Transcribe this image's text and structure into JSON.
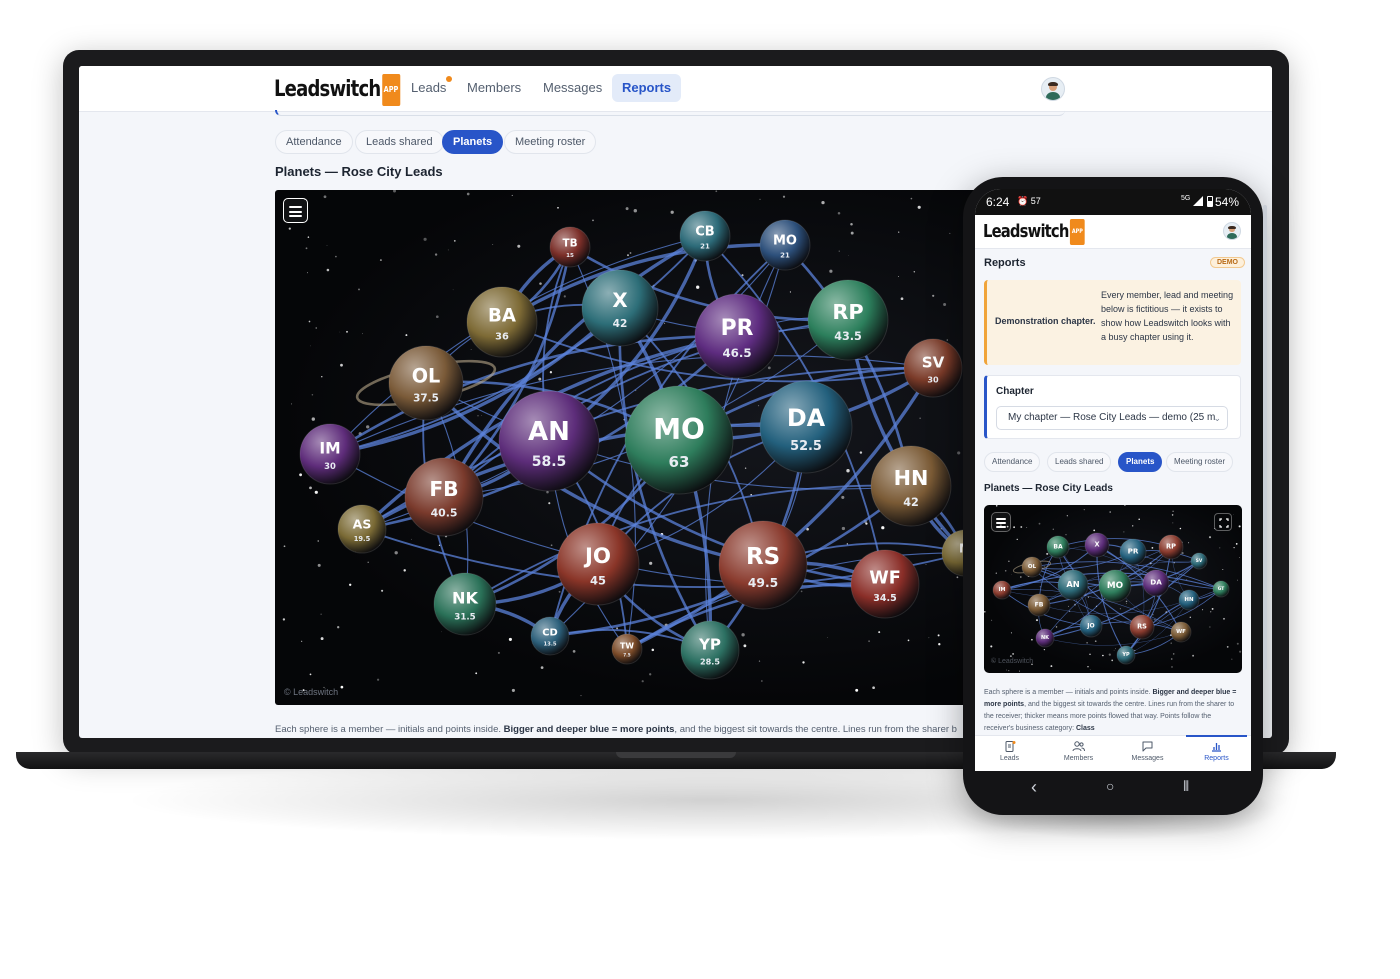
{
  "app": {
    "logo_text": "Leadswitch",
    "logo_tag": "APP"
  },
  "desktop": {
    "nav": [
      {
        "label": "Leads",
        "has_dot": true
      },
      {
        "label": "Members"
      },
      {
        "label": "Messages"
      },
      {
        "label": "Reports",
        "active": true
      }
    ],
    "tabs": [
      {
        "label": "Attendance"
      },
      {
        "label": "Leads shared"
      },
      {
        "label": "Planets",
        "active": true
      },
      {
        "label": "Meeting roster"
      }
    ],
    "title": "Planets — Rose City Leads",
    "copyright": "© Leadswitch",
    "footnote_pre": "Each sphere is a member — initials and points inside. ",
    "footnote_bold": "Bigger and deeper blue = more points",
    "footnote_post": ", and the biggest sit towards the centre. Lines run from the sharer b"
  },
  "phone": {
    "status": {
      "time": "6:24",
      "icons_left": "⏰ 57",
      "network": "5G",
      "battery": "54%"
    },
    "page_title": "Reports",
    "demo_badge": "DEMO",
    "demo_label": "Demonstration chapter.",
    "demo_text": "Every member, lead and meeting below is fictitious — it exists to show how Leadswitch looks with a busy chapter using it.",
    "chapter_label": "Chapter",
    "chapter_select": "My chapter — Rose City Leads — demo (25 m",
    "tabs": [
      {
        "label": "Attendance"
      },
      {
        "label": "Leads shared"
      },
      {
        "label": "Planets",
        "active": true
      },
      {
        "label": "Meeting roster"
      }
    ],
    "title": "Planets — Rose City Leads",
    "copyright": "© Leadswitch",
    "footnote_pre": "Each sphere is a member — initials and points inside. ",
    "footnote_bold1": "Bigger and deeper blue = more points",
    "footnote_mid": ", and the biggest sit towards the centre. Lines run from the sharer to the receiver; thicker means more points flowed that way. Points follow the receiver's business category: ",
    "footnote_bold2": "Class",
    "tabbar": [
      {
        "label": "Leads",
        "icon": "document-icon",
        "has_dot": true
      },
      {
        "label": "Members",
        "icon": "people-icon"
      },
      {
        "label": "Messages",
        "icon": "chat-icon"
      },
      {
        "label": "Reports",
        "icon": "bar-chart-icon",
        "active": true
      }
    ],
    "gestures": {
      "back": "‹",
      "home": "○",
      "recent": "⦀"
    }
  },
  "planets": [
    {
      "initials": "MO",
      "points": 63,
      "color": "#2e7d5c"
    },
    {
      "initials": "AN",
      "points": 58.5,
      "color": "#5d2d7a"
    },
    {
      "initials": "DA",
      "points": 52.5,
      "color": "#23607d"
    },
    {
      "initials": "RS",
      "points": 49.5,
      "color": "#8a3b2e"
    },
    {
      "initials": "PR",
      "points": 46.5,
      "color": "#5e2c80"
    },
    {
      "initials": "JO",
      "points": 45,
      "color": "#8a3528"
    },
    {
      "initials": "RP",
      "points": 43.5,
      "color": "#2c7f5c"
    },
    {
      "initials": "X",
      "points": 42,
      "color": "#2d6e78"
    },
    {
      "initials": "HN",
      "points": 42,
      "color": "#7a5a35"
    },
    {
      "initials": "FB",
      "points": 40.5,
      "color": "#7a3a2c"
    },
    {
      "initials": "OL",
      "points": 37.5,
      "color": "#7a5a38"
    },
    {
      "initials": "BA",
      "points": 36,
      "color": "#7d6a35"
    },
    {
      "initials": "WF",
      "points": 34.5,
      "color": "#8a2e28"
    },
    {
      "initials": "NK",
      "points": 31.5,
      "color": "#2a7158"
    },
    {
      "initials": "IM",
      "points": 30,
      "color": "#5e2c7a"
    },
    {
      "initials": "SV",
      "points": 30,
      "color": "#7a3a28"
    },
    {
      "initials": "YP",
      "points": 28.5,
      "color": "#2c7062"
    },
    {
      "initials": "CB",
      "points": 21,
      "color": "#2c6a78"
    },
    {
      "initials": "MO",
      "points": 21,
      "color": "#2c4f7a"
    },
    {
      "initials": "AS",
      "points": 19.5,
      "color": "#7a6a35"
    },
    {
      "initials": "TB",
      "points": 15,
      "color": "#7a2e28"
    },
    {
      "initials": "CD",
      "points": 13.5,
      "color": "#2c5f7a"
    },
    {
      "initials": "TW",
      "points": 7.5,
      "color": "#7a4a28"
    },
    {
      "initials": "M",
      "points": 0,
      "color": "#7a6a35"
    }
  ],
  "phone_planets": [
    {
      "initials": "BA"
    },
    {
      "initials": "X"
    },
    {
      "initials": "PR"
    },
    {
      "initials": "RP"
    },
    {
      "initials": "OL"
    },
    {
      "initials": "AN"
    },
    {
      "initials": "MO"
    },
    {
      "initials": "DA"
    },
    {
      "initials": "HN"
    },
    {
      "initials": "IM"
    },
    {
      "initials": "FB"
    },
    {
      "initials": "SV"
    },
    {
      "initials": "GT"
    },
    {
      "initials": "NK"
    },
    {
      "initials": "JO"
    },
    {
      "initials": "RS"
    },
    {
      "initials": "WF"
    },
    {
      "initials": "YP"
    }
  ],
  "colors": {
    "accent": "#2855c8",
    "link_line": "#5b82d9",
    "demo_orange": "#f0a43a"
  }
}
